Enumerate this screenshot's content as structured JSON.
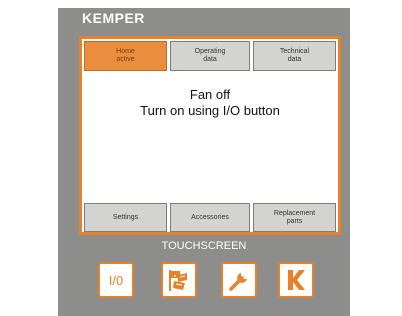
{
  "brand": {
    "name": "KEMPER"
  },
  "tabs_top": [
    {
      "label": "Home\nactive",
      "active": true
    },
    {
      "label": "Operating\ndata",
      "active": false
    },
    {
      "label": "Technical\ndata",
      "active": false
    }
  ],
  "tabs_bottom": [
    {
      "label": "Settings"
    },
    {
      "label": "Accessories"
    },
    {
      "label": "Replacement\nparts"
    }
  ],
  "message": {
    "line1": "Fan off",
    "line2": "Turn on using I/O button"
  },
  "touchscreen_label": "TOUCHSCREEN",
  "buttons": {
    "io": {
      "label": "I/0",
      "icon": "power-io-icon"
    },
    "flags": {
      "icon": "flags-icon"
    },
    "wrench": {
      "icon": "wrench-icon"
    },
    "k": {
      "icon": "kemper-k-icon"
    }
  },
  "colors": {
    "accent": "#e8822a",
    "panel": "#8d8d8b",
    "tab": "#d3d3d1",
    "tab_active": "#e98e3e"
  }
}
